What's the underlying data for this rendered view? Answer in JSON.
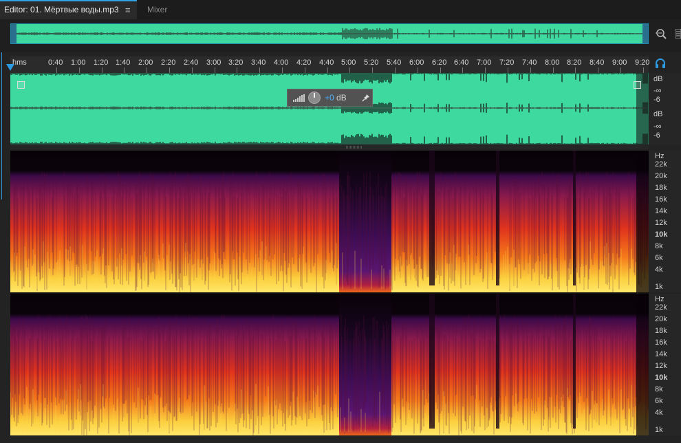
{
  "tabs": {
    "editor_label": "Editor: 01. Мёртвые воды.mp3",
    "menu_glyph": "≡",
    "mixer_label": "Mixer"
  },
  "ruler": {
    "unit": "hms",
    "ticks": [
      "0:40",
      "1:00",
      "1:20",
      "1:40",
      "2:00",
      "2:20",
      "2:40",
      "3:00",
      "3:20",
      "3:40",
      "4:00",
      "4:20",
      "4:40",
      "5:00",
      "5:20",
      "5:40",
      "6:00",
      "6:20",
      "6:40",
      "7:00",
      "7:20",
      "7:40",
      "8:00",
      "8:20",
      "8:40",
      "9:00",
      "9:20"
    ]
  },
  "hud": {
    "value": "+0",
    "unit": "dB"
  },
  "db_scale": {
    "top": [
      "dB",
      "-∞",
      "-6"
    ],
    "bottom": [
      "dB",
      "-∞",
      "-6"
    ]
  },
  "hz_scale": {
    "labels": [
      "Hz",
      "22k",
      "20k",
      "18k",
      "16k",
      "14k",
      "12k",
      "10k",
      "8k",
      "6k",
      "4k",
      "1k"
    ]
  },
  "colors": {
    "waveform": "#3ed99f",
    "accent": "#2e9be0",
    "background": "#232323"
  },
  "icons": {
    "zoom": "zoom-icon",
    "list": "list-icon",
    "headphone": "headphone-icon",
    "pin": "pin-icon",
    "meter": "level-meter-icon"
  }
}
